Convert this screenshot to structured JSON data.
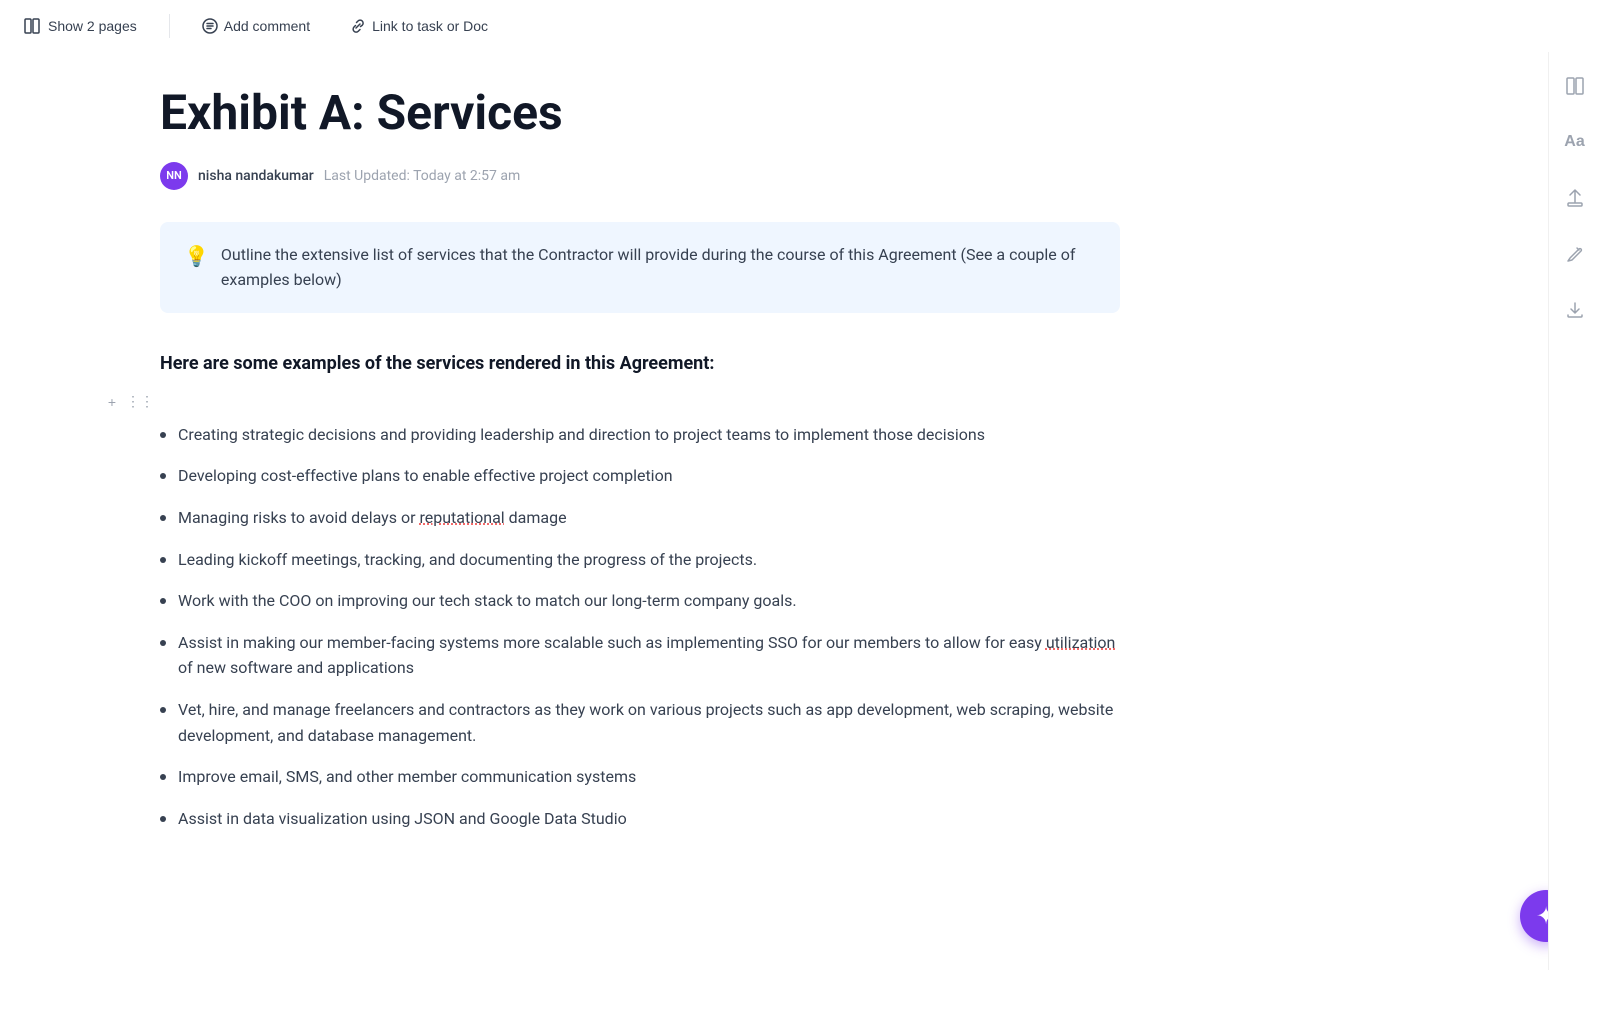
{
  "toolbar": {
    "show_pages_label": "Show 2 pages",
    "add_comment_label": "Add comment",
    "link_label": "Link to task or Doc"
  },
  "right_sidebar": {
    "icons": [
      "layout-icon",
      "text-icon",
      "share-icon",
      "edit-icon",
      "export-icon"
    ]
  },
  "document": {
    "title": "Exhibit A: Services",
    "author": {
      "initials": "NN",
      "name": "nisha nandakumar",
      "last_updated": "Last Updated: Today at 2:57 am"
    },
    "callout": {
      "icon": "💡",
      "text": "Outline the extensive list of services that the Contractor will provide during the course of this Agreement (See a couple of examples below)"
    },
    "section_heading": "Here are some examples of the services rendered in this Agreement:",
    "bullet_items": [
      "Creating strategic decisions and providing leadership and direction to project teams to implement those decisions",
      "Developing cost-effective plans to enable effective project completion",
      "Managing risks to avoid delays or reputational damage",
      "Leading kickoff meetings, tracking, and documenting the progress of the projects.",
      "Work with the COO on improving our tech stack to match our long-term company goals.",
      "Assist in making our member-facing systems more scalable such as implementing SSO for our members to allow for easy utilization of new software and applications",
      "Vet, hire, and manage freelancers and contractors as they work on various projects such as app development, web scraping, website development, and database management.",
      "Improve email, SMS, and other member communication systems",
      "Assist in data visualization using JSON and Google Data Studio"
    ]
  },
  "fab": {
    "icon": "✦"
  }
}
